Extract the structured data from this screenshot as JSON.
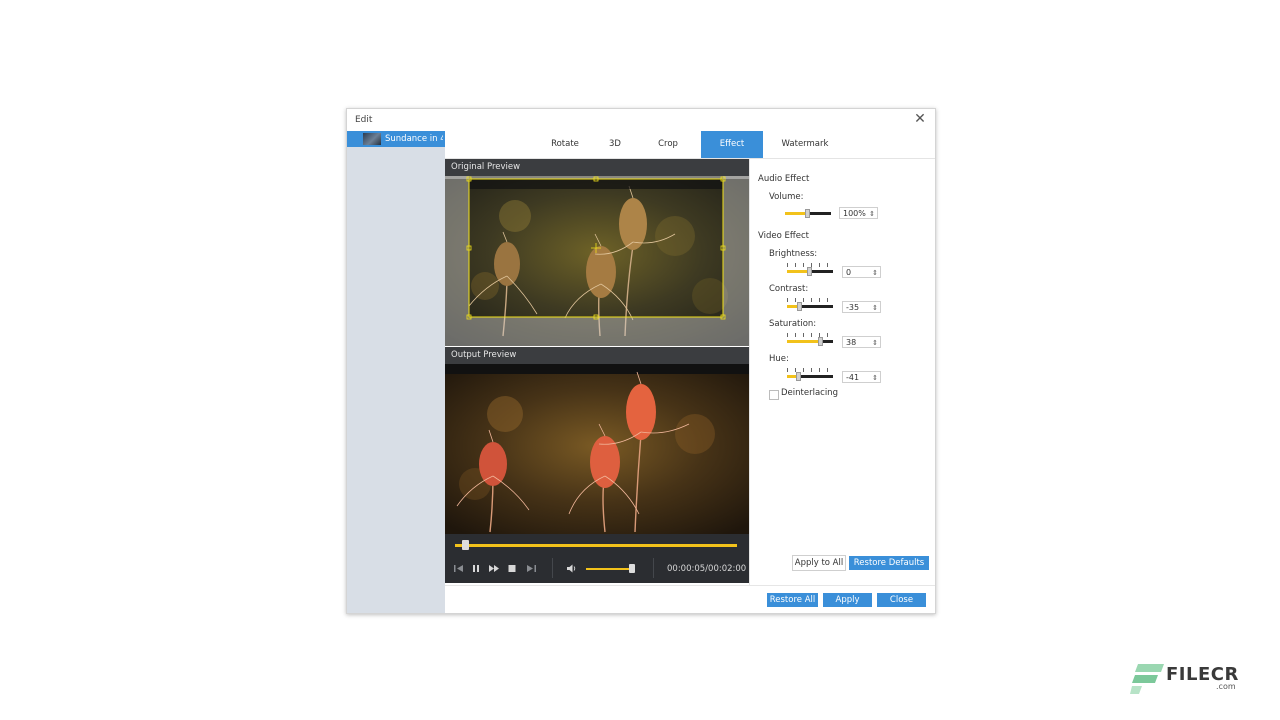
{
  "dialog": {
    "title": "Edit",
    "file_name": "Sundance in 4..."
  },
  "tabs": [
    {
      "label": "Rotate",
      "active": false
    },
    {
      "label": "3D",
      "active": false
    },
    {
      "label": "Crop",
      "active": false
    },
    {
      "label": "Effect",
      "active": true
    },
    {
      "label": "Watermark",
      "active": false
    }
  ],
  "preview": {
    "original_label": "Original Preview",
    "output_label": "Output Preview"
  },
  "player": {
    "seek_fraction": 0.025,
    "volume_fraction": 0.95,
    "timecode": "00:00:05/00:02:00"
  },
  "effects": {
    "audio_section": "Audio Effect",
    "volume_label": "Volume:",
    "volume_value": "100%",
    "video_section": "Video Effect",
    "brightness_label": "Brightness:",
    "brightness_value": "0",
    "contrast_label": "Contrast:",
    "contrast_value": "-35",
    "saturation_label": "Saturation:",
    "saturation_value": "38",
    "hue_label": "Hue:",
    "hue_value": "-41",
    "deinterlacing_label": "Deinterlacing",
    "deinterlacing_checked": false
  },
  "buttons": {
    "apply_to_all": "Apply to All",
    "restore_defaults": "Restore Defaults",
    "restore_all": "Restore All",
    "apply": "Apply",
    "close": "Close"
  },
  "watermark_logo": {
    "text": "FILECR",
    "sub": ".com"
  },
  "colors": {
    "accent": "#3a8fd9",
    "slider_fill": "#f2c21b",
    "dark_header": "#3b3d40"
  }
}
